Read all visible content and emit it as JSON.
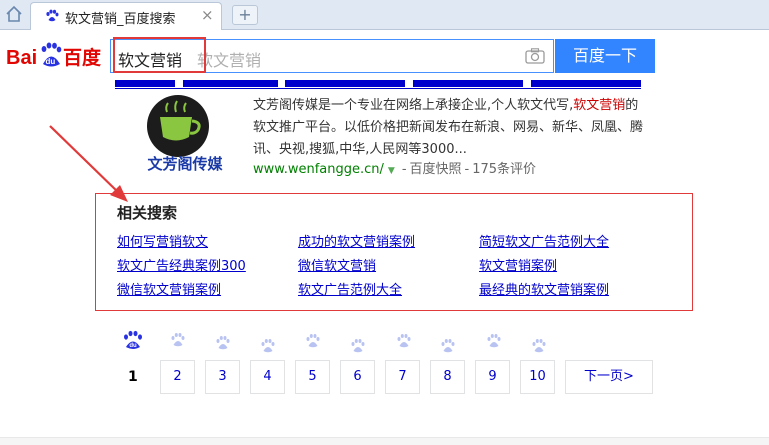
{
  "browser": {
    "tab_title": "软文营销_百度搜索",
    "tab_close": "×",
    "new_tab": "+"
  },
  "colors": {
    "brand_blue": "#3385ff",
    "brand_red": "#e10602",
    "link": "#0000cc",
    "url_green": "#008000",
    "annotation_red": "#e03a3a"
  },
  "header": {
    "logo_text": [
      "Bai",
      "du",
      "百度"
    ],
    "query": "软文营销",
    "query_hint": "软文营销",
    "search_button": "百度一下"
  },
  "result": {
    "logo_caption": "文芳阁传媒",
    "desc_before": "文芳阁传媒是一个专业在网络上承接企业,个人软文代写,",
    "desc_highlight": "软文营销",
    "desc_after": "的软文推广平台。以低价格把新闻发布在新浪、网易、新华、凤凰、腾讯、央视,搜狐,中华,人民网等3000...",
    "url": "www.wenfangge.cn/",
    "snapshot": "百度快照",
    "reviews": "175条评价"
  },
  "related": {
    "title": "相关搜索",
    "links": [
      [
        "如何写营销软文",
        "成功的软文营销案例",
        "简短软文广告范例大全"
      ],
      [
        "软文广告经典案例300",
        "微信软文营销",
        "软文营销案例"
      ],
      [
        "微信软文营销案例",
        "软文广告范例大全",
        "最经典的软文营销案例"
      ]
    ]
  },
  "pager": {
    "current": "1",
    "pages": [
      "2",
      "3",
      "4",
      "5",
      "6",
      "7",
      "8",
      "9",
      "10"
    ],
    "next": "下一页>"
  }
}
